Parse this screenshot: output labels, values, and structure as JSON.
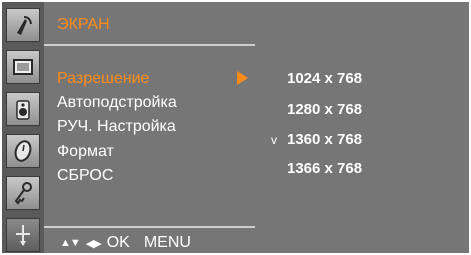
{
  "rail": {
    "icons": [
      "satellite-antenna-icon",
      "picture-screen-icon",
      "audio-speaker-icon",
      "clock-icon",
      "key-icon",
      "mouse-cursor-icon"
    ],
    "active_index": 5
  },
  "menu": {
    "title": "ЭКРАН",
    "items": [
      {
        "label": "Разрешение"
      },
      {
        "label": "Автоподстройка"
      },
      {
        "label": "РУЧ. Настройка"
      },
      {
        "label": "Формат"
      },
      {
        "label": "СБРОС"
      }
    ],
    "active_item": "Разрешение",
    "hints": {
      "ok": "OK",
      "menu": "MENU"
    }
  },
  "resolutions": {
    "options": [
      "1024 x 768",
      "1280 x 768",
      "1360 x 768",
      "1366 x 768"
    ],
    "selected": "1360 x 768",
    "check_mark": "v"
  },
  "colors": {
    "accent": "#ff8c1a",
    "panel": "#767676",
    "rail": "#5a5a5a",
    "text": "#ffffff"
  }
}
